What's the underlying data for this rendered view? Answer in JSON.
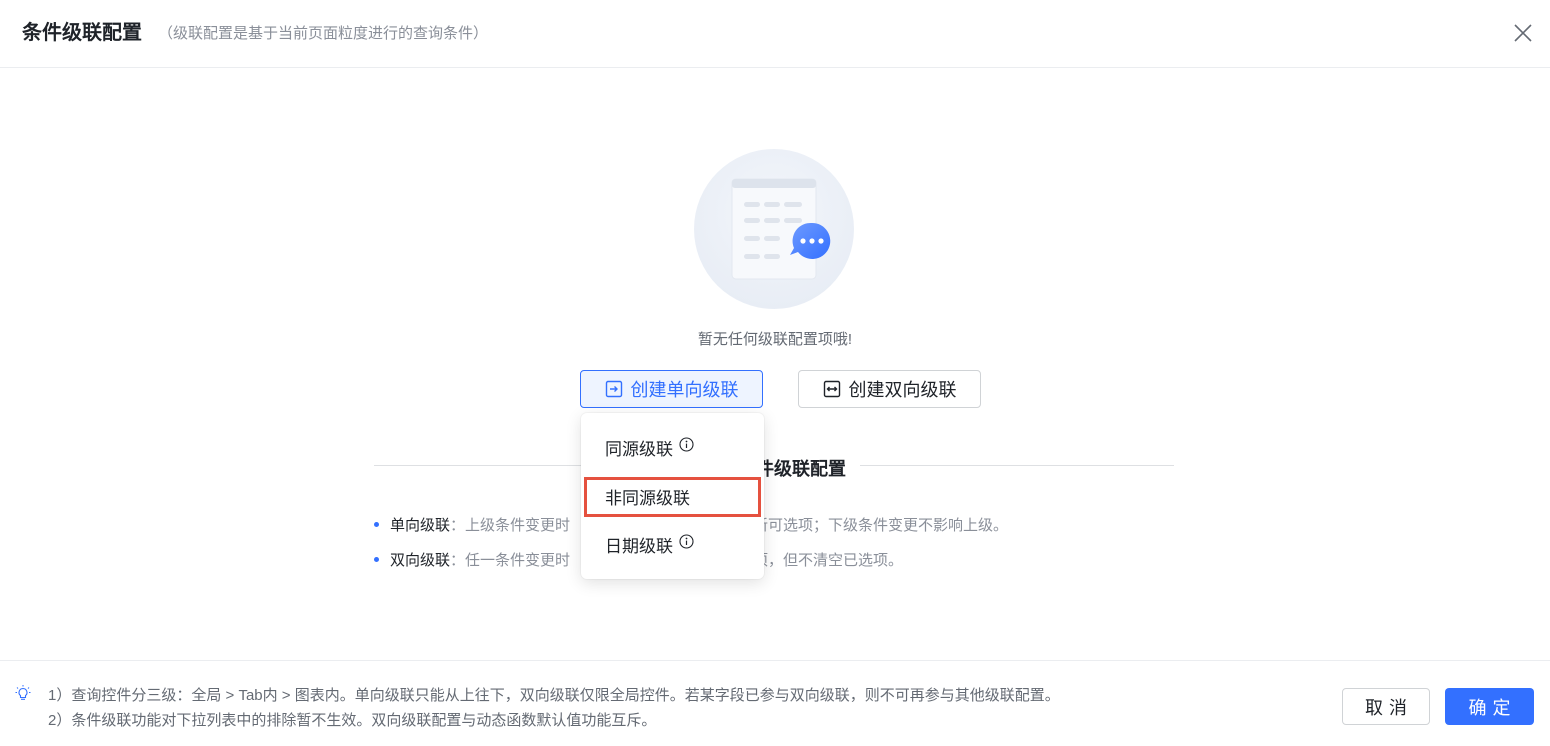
{
  "header": {
    "title": "条件级联配置",
    "subtitle": "（级联配置是基于当前页面粒度进行的查询条件）"
  },
  "empty_state": {
    "message": "暂无任何级联配置项哦!"
  },
  "actions": {
    "create_single": "创建单向级联",
    "create_double": "创建双向级联"
  },
  "dropdown": {
    "items": [
      {
        "label": "同源级联",
        "has_info": true
      },
      {
        "label": "非同源级联",
        "has_info": false
      },
      {
        "label": "日期级联",
        "has_info": true
      }
    ]
  },
  "section": {
    "title_visible": "件级联配置",
    "desc1_term": "单向级联",
    "desc1_left": "：上级条件变更时",
    "desc1_right": "新可选项；下级条件变更不影响上级。",
    "desc2_term": "双向级联",
    "desc2_left": "：任一条件变更时",
    "desc2_right": "项，但不清空已选项。"
  },
  "footer": {
    "tip1": "1）查询控件分三级：全局 > Tab内 > 图表内。单向级联只能从上往下，双向级联仅限全局控件。若某字段已参与双向级联，则不可再参与其他级联配置。",
    "tip2": "2）条件级联功能对下拉列表中的排除暂不生效。双向级联配置与动态函数默认值功能互斥。",
    "cancel_label": "取消",
    "ok_label": "确定"
  },
  "colors": {
    "primary": "#3370ff",
    "highlight": "#e5513f"
  }
}
